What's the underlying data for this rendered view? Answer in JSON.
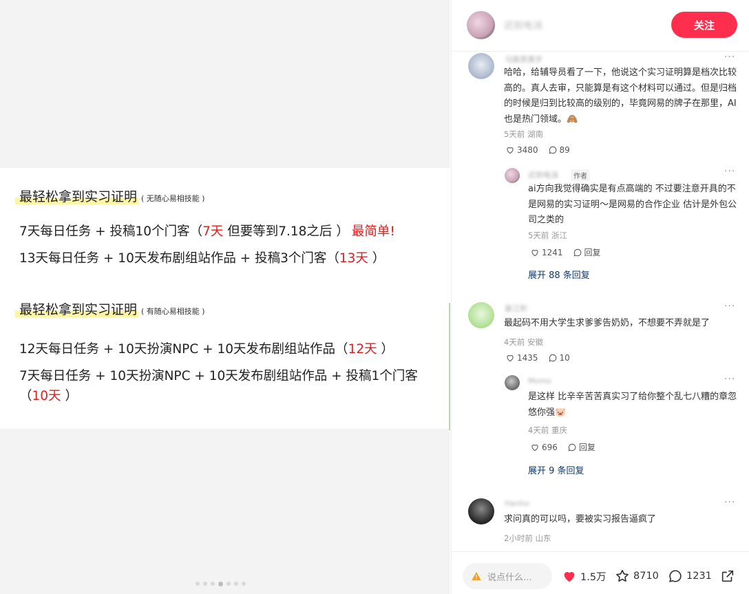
{
  "slide": {
    "section1": {
      "title": "最轻松拿到实习证明",
      "note": "( 无随心易相技能 )",
      "lines": [
        {
          "pre": "7天每日任务 + 投稿10个门客（",
          "hl": "7天",
          "post": " 但要等到7.18之后 ）",
          "tail": "最简单!"
        },
        {
          "pre": "13天每日任务 + 10天发布剧组站作品 + 投稿3个门客（",
          "hl": "13天",
          "post": " ）"
        }
      ]
    },
    "section2": {
      "title": "最轻松拿到实习证明",
      "note": "( 有随心易相技能 )",
      "lines": [
        {
          "pre": "12天每日任务 + 10天扮演NPC + 10天发布剧组站作品（",
          "hl": "12天",
          "post": " ）"
        },
        {
          "pre": "7天每日任务 + 10天扮演NPC + 10天发布剧组站作品 + 投稿1个门客（",
          "hl": "10天",
          "post": " ）"
        }
      ]
    },
    "dots_total": 7,
    "dots_active": 4
  },
  "header": {
    "author_name": "迟到电消",
    "follow_label": "关注"
  },
  "comments": [
    {
      "name": "马路茶唐岁",
      "text": "哈哈，给辅导员看了一下，他说这个实习证明算是档次比较高的。真人去审，只能算是有这个材料可以通过。但是归档的时候是归到比较高的级别的，毕竟网易的牌子在那里，AI也是热门领域。🙈",
      "meta": "5天前 湖南",
      "likes": "3480",
      "replies": "89",
      "reply": {
        "name": "迟到电消",
        "tag": "作者",
        "text": "ai方向我觉得确实是有点高端的 不过要注意开具的不是网易的实习证明～是网易的合作企业 估计是外包公司之类的",
        "meta": "5天前 浙江",
        "likes": "1241",
        "reply_label": "回复"
      },
      "expand": "展开 88 条回复"
    },
    {
      "name": "豪江积",
      "text": "最起码不用大学生求爹爹告奶奶，不想要不弄就是了",
      "meta": "4天前 安徽",
      "likes": "1435",
      "replies": "10",
      "reply": {
        "name": "Momo",
        "text": "是这样 比辛辛苦苦真实习了给你整个乱七八糟的章忽悠你强🐷",
        "meta": "4天前 重庆",
        "likes": "696",
        "reply_label": "回复"
      },
      "expand": "展开 9 条回复"
    },
    {
      "name": "Hanho",
      "text": "求问真的可以吗，要被实习报告逼疯了",
      "meta": "2小时前 山东"
    }
  ],
  "bottom": {
    "input_placeholder": "说点什么...",
    "likes": "1.5万",
    "stars": "8710",
    "comments": "1231"
  },
  "colors": {
    "accent": "#ff2e4d",
    "highlight_red": "#e01e1e",
    "link_blue": "#13386c"
  }
}
